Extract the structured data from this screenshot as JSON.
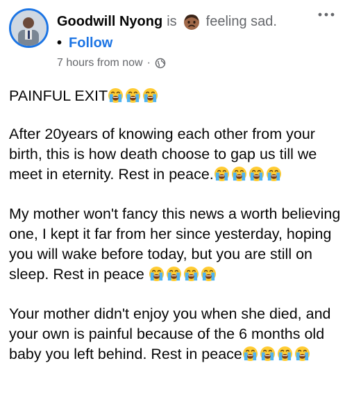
{
  "post": {
    "author": "Goodwill Nyong",
    "is_word": "is",
    "feeling_text": "feeling sad.",
    "feeling_icon": "sad-face-emoji",
    "follow_bullet": "•",
    "follow_label": "Follow",
    "timestamp": "7 hours from now",
    "meta_separator": "·",
    "privacy_icon": "globe-icon",
    "more_icon": "more-options-icon",
    "paragraphs": [
      {
        "text": "PAINFUL EXIT",
        "emoji_count": 3
      },
      {
        "text": "After 20years of knowing each other from your birth, this is how death choose to gap us till we meet in eternity. Rest in peace.",
        "emoji_count": 4
      },
      {
        "text": "My mother won't fancy this news a worth believing one, I kept it far from her since yesterday, hoping you will wake before today, but you are still on sleep. Rest in peace ",
        "emoji_count": 4
      },
      {
        "text": "Your mother didn't enjoy you when she died, and your own is painful because of the 6 months old baby you left behind. Rest in peace",
        "emoji_count": 4
      }
    ],
    "emoji_icon": "crying-face-emoji",
    "colors": {
      "accent": "#1b74e4",
      "secondary_text": "#65676b",
      "primary_text": "#050505"
    }
  }
}
